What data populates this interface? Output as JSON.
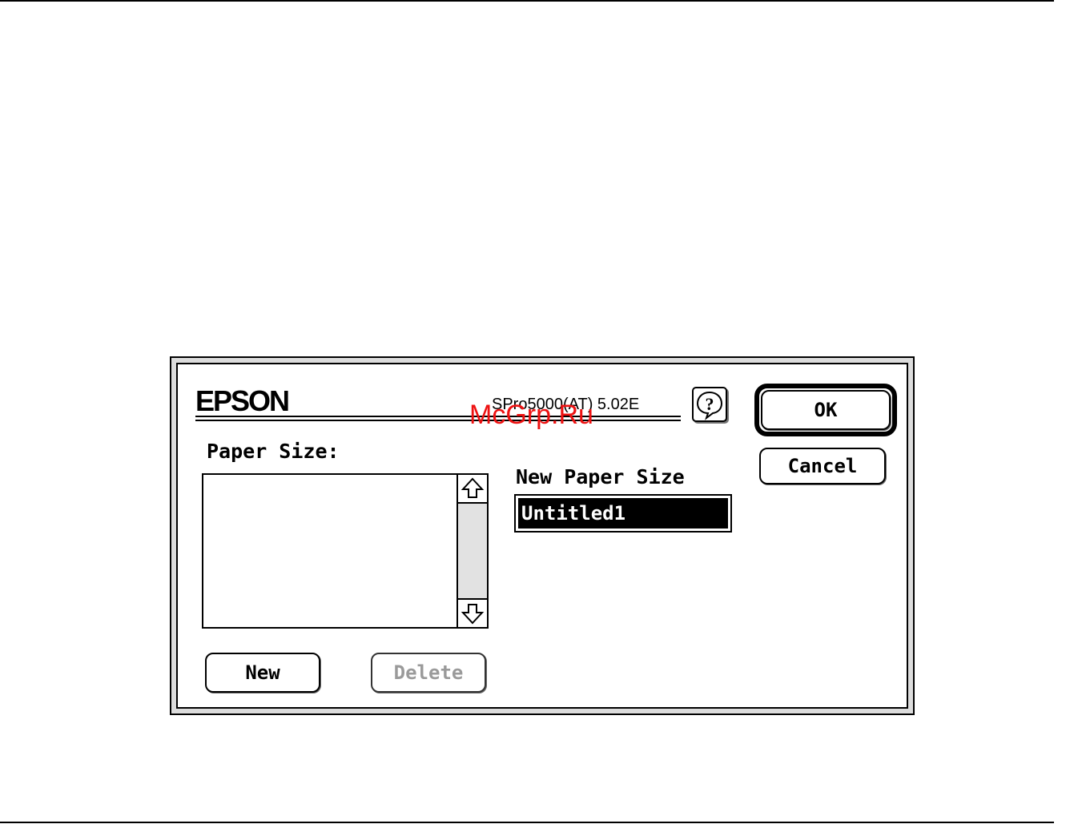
{
  "dialog": {
    "brand": "EPSON",
    "driver_version": "SPro5000(AT) 5.02E",
    "watermark": "McGrp.Ru",
    "help_icon": "help-balloon-icon",
    "ok_label": "OK",
    "cancel_label": "Cancel",
    "paper_size_label": "Paper Size:",
    "new_paper_size_label": "New Paper Size",
    "new_paper_size_value": "Untitled1",
    "new_label": "New",
    "delete_label": "Delete",
    "scroll_up_icon": "arrow-up-icon",
    "scroll_down_icon": "arrow-down-icon",
    "delete_disabled": true
  },
  "colors": {
    "watermark": "#ee1111",
    "disabled_text": "#9a9a9a",
    "frame": "#dcdcdc",
    "scroll_track": "#e2e2e2"
  }
}
